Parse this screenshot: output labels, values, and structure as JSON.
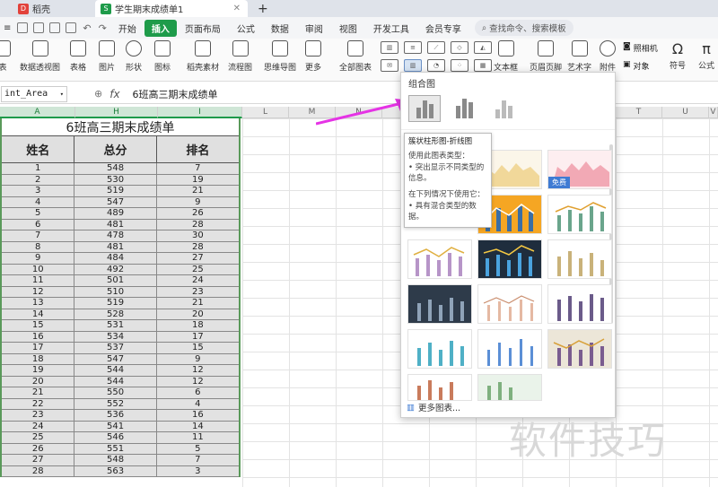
{
  "tabs": [
    {
      "label": "稻壳",
      "badge": "D",
      "badge_color": "#e2423b"
    },
    {
      "label": "学生期末成绩单1",
      "badge": "S",
      "badge_color": "#1e9b4a"
    }
  ],
  "new_tab": "+",
  "menu": [
    "开始",
    "插入",
    "页面布局",
    "公式",
    "数据",
    "审阅",
    "视图",
    "开发工具",
    "会员专享"
  ],
  "menu_active": "插入",
  "search_placeholder": "查找命令、搜索模板",
  "ribbon": {
    "items": [
      "表",
      "数据透视图",
      "表格",
      "图片",
      "形状",
      "图标",
      "稻壳素材",
      "流程图",
      "思维导图",
      "更多",
      "全部图表",
      "文本框",
      "页眉页脚",
      "艺术字",
      "附件",
      "照相机",
      "对象",
      "符号",
      "公式"
    ]
  },
  "formula_bar": {
    "name_box": "int_Area",
    "fx": "fx",
    "value": "6班高三期末成绩单"
  },
  "columns": [
    "A",
    "H",
    "I",
    "L",
    "M",
    "N",
    "O",
    "P",
    "T",
    "U",
    "V"
  ],
  "sheet": {
    "title": "6班高三期末成绩单",
    "headers": [
      "姓名",
      "总分",
      "排名"
    ],
    "rows": [
      [
        "1",
        "548",
        "7"
      ],
      [
        "2",
        "530",
        "19"
      ],
      [
        "3",
        "519",
        "21"
      ],
      [
        "4",
        "547",
        "9"
      ],
      [
        "5",
        "489",
        "26"
      ],
      [
        "6",
        "481",
        "28"
      ],
      [
        "7",
        "478",
        "30"
      ],
      [
        "8",
        "481",
        "28"
      ],
      [
        "9",
        "484",
        "27"
      ],
      [
        "10",
        "492",
        "25"
      ],
      [
        "11",
        "501",
        "24"
      ],
      [
        "12",
        "510",
        "23"
      ],
      [
        "13",
        "519",
        "21"
      ],
      [
        "14",
        "528",
        "20"
      ],
      [
        "15",
        "531",
        "18"
      ],
      [
        "16",
        "534",
        "17"
      ],
      [
        "17",
        "537",
        "15"
      ],
      [
        "18",
        "547",
        "9"
      ],
      [
        "19",
        "544",
        "12"
      ],
      [
        "20",
        "544",
        "12"
      ],
      [
        "21",
        "550",
        "6"
      ],
      [
        "22",
        "552",
        "4"
      ],
      [
        "23",
        "536",
        "16"
      ],
      [
        "24",
        "541",
        "14"
      ],
      [
        "25",
        "546",
        "11"
      ],
      [
        "26",
        "551",
        "5"
      ],
      [
        "27",
        "548",
        "7"
      ],
      [
        "28",
        "563",
        "3"
      ]
    ]
  },
  "popup": {
    "header": "组合图",
    "tooltip_title": "簇状柱形图-折线图",
    "tooltip_usage_label": "使用此图表类型：",
    "tooltip_usage": "• 突出显示不同类型的信息。",
    "tooltip_when_label": "在下列情况下使用它：",
    "tooltip_when": "• 具有混合类型的数据。",
    "free_badge": "免费",
    "more_charts": "更多图表..."
  },
  "watermark": "软件技巧",
  "colors": {
    "accent": "#1e9b4a",
    "arrow": "#e533e5"
  }
}
